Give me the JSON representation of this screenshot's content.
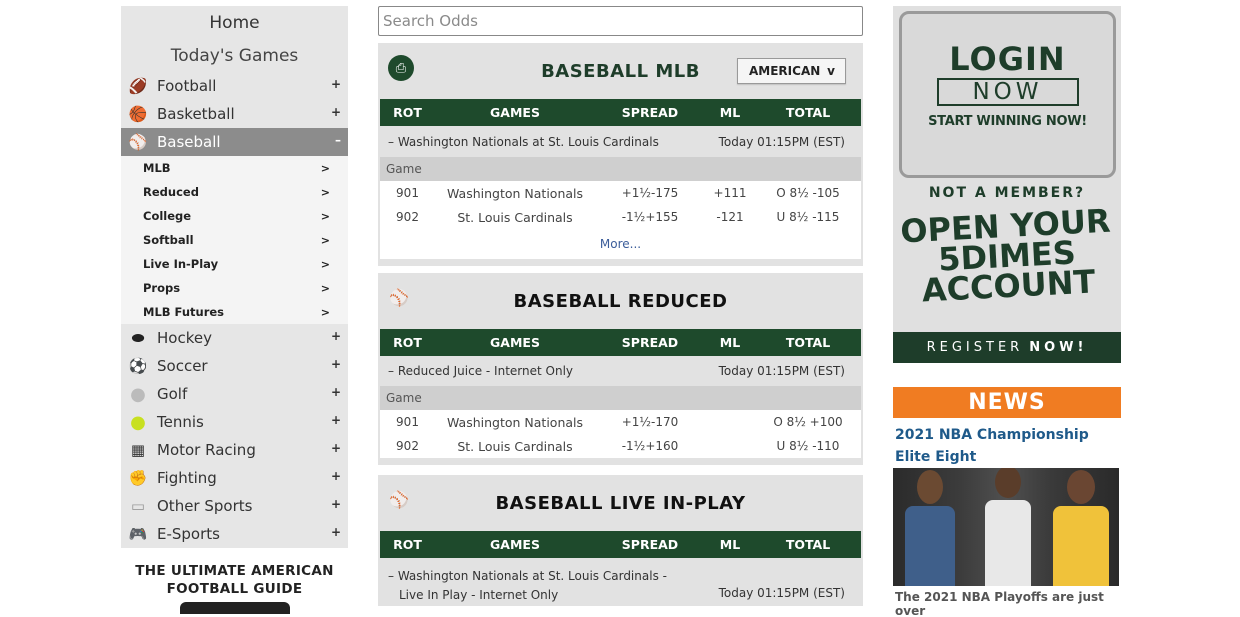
{
  "sidebar": {
    "home": "Home",
    "today": "Today's Games",
    "sports": [
      {
        "label": "Football",
        "icon": "football-icon",
        "glyph": "🏈",
        "sign": "+"
      },
      {
        "label": "Basketball",
        "icon": "basketball-icon",
        "glyph": "🏀",
        "sign": "+"
      },
      {
        "label": "Baseball",
        "icon": "baseball-icon",
        "glyph": "⚾",
        "sign": "–"
      }
    ],
    "baseball_sub": [
      {
        "label": "MLB",
        "arrow": ">"
      },
      {
        "label": "Reduced",
        "arrow": ">"
      },
      {
        "label": "College",
        "arrow": ">"
      },
      {
        "label": "Softball",
        "arrow": ">"
      },
      {
        "label": "Live In-Play",
        "arrow": ">"
      },
      {
        "label": "Props",
        "arrow": ">"
      },
      {
        "label": "MLB Futures",
        "arrow": ">"
      }
    ],
    "more_sports": [
      {
        "label": "Hockey",
        "icon": "hockey-puck-icon",
        "glyph": "⬬",
        "sign": "+"
      },
      {
        "label": "Soccer",
        "icon": "soccer-ball-icon",
        "glyph": "⚽",
        "sign": "+"
      },
      {
        "label": "Golf",
        "icon": "golf-ball-icon",
        "glyph": "●",
        "sign": "+"
      },
      {
        "label": "Tennis",
        "icon": "tennis-ball-icon",
        "glyph": "●",
        "sign": "+"
      },
      {
        "label": "Motor Racing",
        "icon": "checkered-flag-icon",
        "glyph": "▦",
        "sign": "+"
      },
      {
        "label": "Fighting",
        "icon": "boxing-glove-icon",
        "glyph": "✊",
        "sign": "+"
      },
      {
        "label": "Other Sports",
        "icon": "other-sports-icon",
        "glyph": "▭",
        "sign": "+"
      },
      {
        "label": "E-Sports",
        "icon": "gamepad-icon",
        "glyph": "🎮",
        "sign": "+"
      }
    ],
    "guide_line1": "THE ULTIMATE AMERICAN",
    "guide_line2": "FOOTBALL GUIDE"
  },
  "search": {
    "placeholder": "Search Odds"
  },
  "columns": {
    "rot": "ROT",
    "games": "GAMES",
    "spread": "SPREAD",
    "ml": "ML",
    "total": "TOTAL"
  },
  "panels": {
    "mlb": {
      "title": "BASEBALL MLB",
      "odds_format": "AMERICAN",
      "odds_arrow": "v",
      "event": "– Washington Nationals at St. Louis Cardinals",
      "time": "Today 01:15PM (EST)",
      "game_label": "Game",
      "rows": [
        {
          "rot": "901",
          "team": "Washington Nationals",
          "spread": "+1½-175",
          "ml": "+111",
          "total": "O 8½ -105"
        },
        {
          "rot": "902",
          "team": "St. Louis Cardinals",
          "spread": "-1½+155",
          "ml": "-121",
          "total": "U 8½ -115"
        }
      ],
      "more": "More..."
    },
    "reduced": {
      "title": "BASEBALL REDUCED",
      "event": "– Reduced Juice - Internet Only",
      "time": "Today 01:15PM (EST)",
      "game_label": "Game",
      "rows": [
        {
          "rot": "901",
          "team": "Washington Nationals",
          "spread": "+1½-170",
          "ml": "",
          "total": "O 8½ +100"
        },
        {
          "rot": "902",
          "team": "St. Louis Cardinals",
          "spread": "-1½+160",
          "ml": "",
          "total": "U 8½ -110"
        }
      ]
    },
    "live": {
      "title": "BASEBALL LIVE IN-PLAY",
      "event_line1": "– Washington Nationals at St. Louis Cardinals -",
      "event_line2": "Live In Play - Internet Only",
      "time": "Today 01:15PM (EST)"
    }
  },
  "ad": {
    "login": "LOGIN",
    "now": "NOW",
    "start": "START WINNING NOW!",
    "member": "NOT A MEMBER?",
    "open1": "OPEN YOUR",
    "open2": "5DIMES",
    "open3": "ACCOUNT",
    "register": "REGISTER",
    "register_now": "NOW!"
  },
  "news": {
    "header": "NEWS",
    "title": "2021 NBA Championship Elite Eight",
    "snippet": "The 2021 NBA Playoffs are just over"
  },
  "colors": {
    "brand_green": "#1e4a2c",
    "news_orange": "#f07c22",
    "active_gray": "#8c8c8c"
  }
}
